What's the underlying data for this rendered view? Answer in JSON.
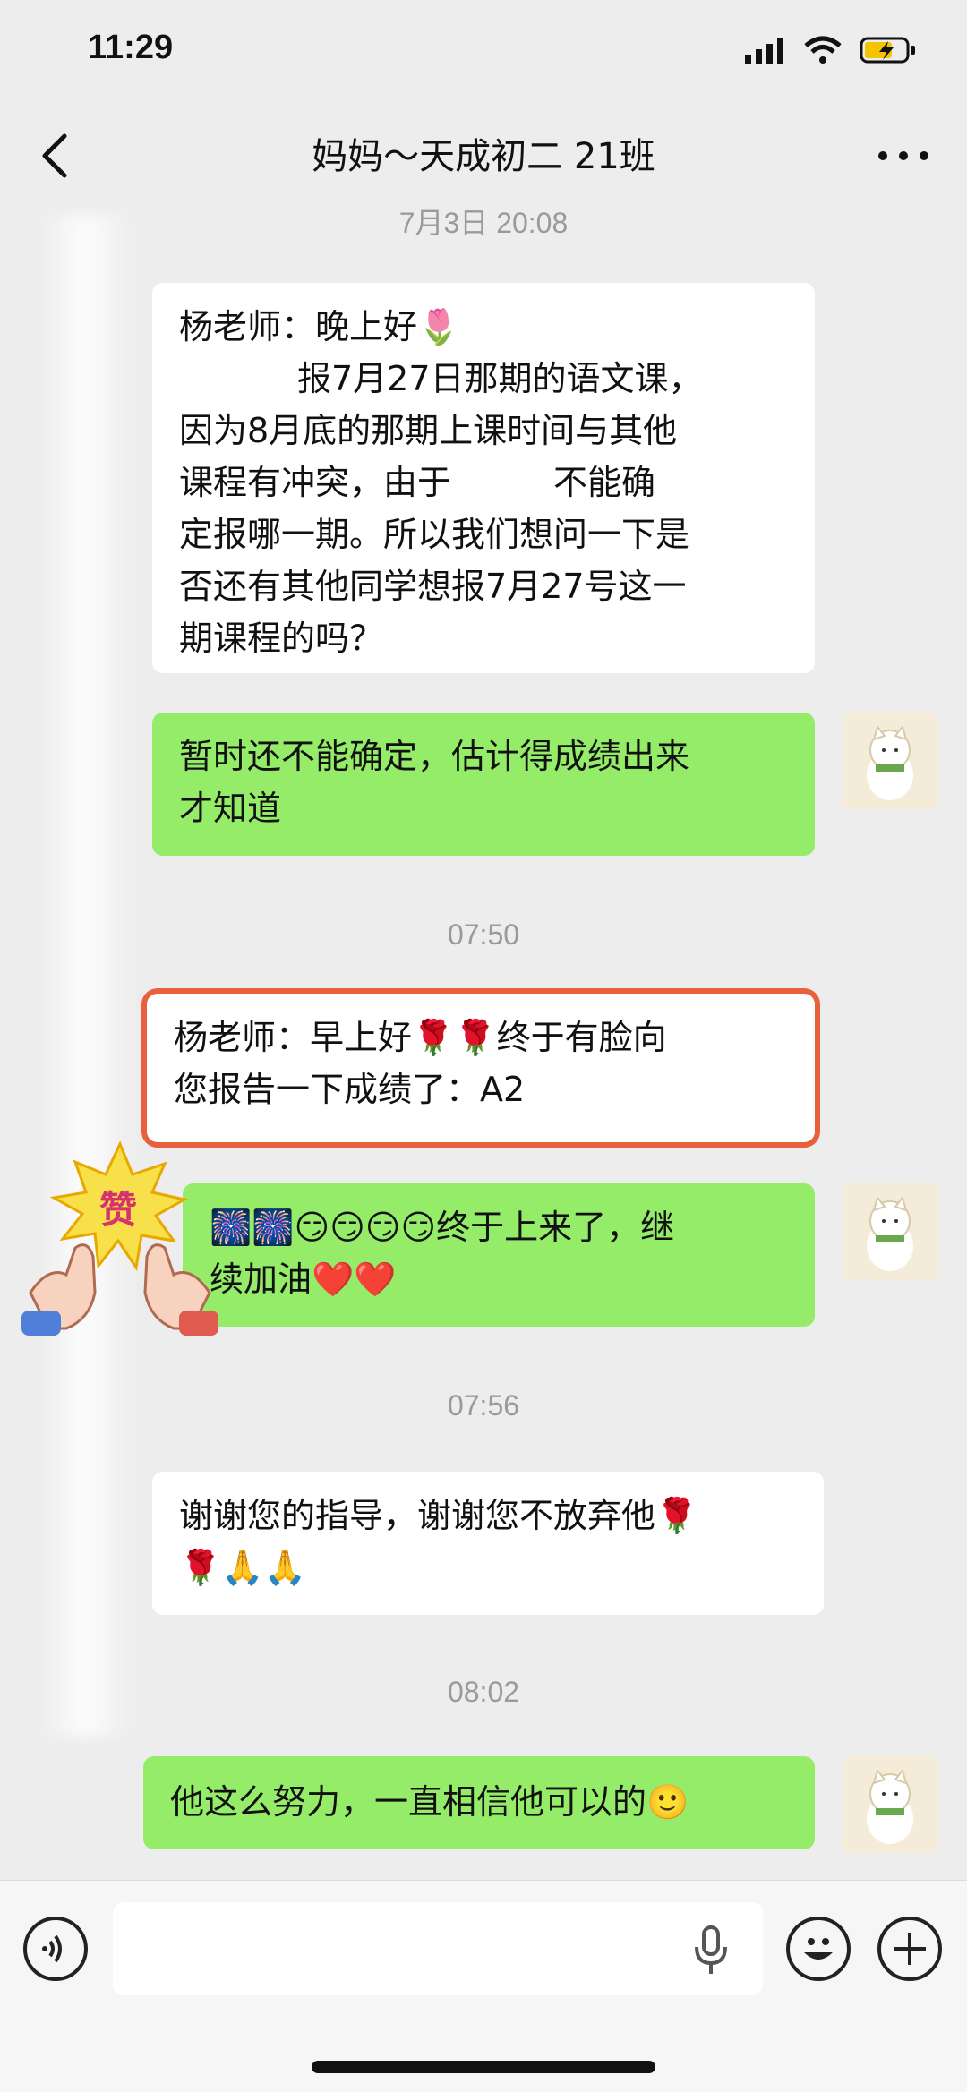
{
  "status_bar": {
    "time": "11:29"
  },
  "nav": {
    "title": "妈妈～天成初二 21班"
  },
  "messages": [
    {
      "kind": "timestamp",
      "text": "7月3日 20:08"
    },
    {
      "kind": "recv",
      "lines": [
        "杨老师：晚上好🌷",
        "报7月27日那期的语文课，",
        "因为8月底的那期上课时间与其他",
        "课程有冲突，由于　　　不能确",
        "定报哪一期。所以我们想问一下是",
        "否还有其他同学想报7月27号这一",
        "期课程的吗？"
      ]
    },
    {
      "kind": "sent",
      "lines": [
        "暂时还不能确定，估计得成绩出来",
        "才知道"
      ]
    },
    {
      "kind": "timestamp",
      "text": "07:50"
    },
    {
      "kind": "recv",
      "lines": [
        "杨老师：早上好🌹🌹终于有脸向",
        "您报告一下成绩了：A2"
      ]
    },
    {
      "kind": "sent",
      "lines": [
        "🎆🎆😏😏😏😏终于上来了，继",
        "续加油❤️❤️"
      ]
    },
    {
      "kind": "timestamp",
      "text": "07:56"
    },
    {
      "kind": "recv",
      "lines": [
        "谢谢您的指导，谢谢您不放弃他🌹",
        "🌹🙏🙏"
      ]
    },
    {
      "kind": "timestamp",
      "text": "08:02"
    },
    {
      "kind": "sent",
      "lines": [
        "他这么努力，一直相信他可以的🙂"
      ]
    }
  ],
  "sticker": {
    "text": "赞"
  },
  "colors": {
    "sent_bubble": "#95ec69",
    "recv_bubble": "#ffffff",
    "highlight": "#e8603c",
    "background": "#ededed"
  }
}
